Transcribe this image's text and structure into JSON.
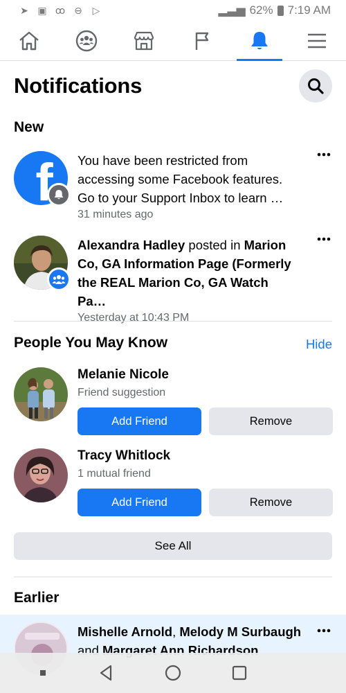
{
  "status": {
    "battery": "62%",
    "time": "7:19 AM"
  },
  "header": {
    "title": "Notifications"
  },
  "sections": {
    "new": "New",
    "people": "People You May Know",
    "hide": "Hide",
    "earlier": "Earlier"
  },
  "notifications": [
    {
      "text": "You have been restricted from accessing some Facebook features. Go to your Support Inbox to learn …",
      "time": "31 minutes ago"
    },
    {
      "name": "Alexandra Hadley",
      "action": " posted in ",
      "group": "Marion Co, GA Information Page (Formerly the REAL Marion Co, GA Watch Pa…",
      "time": "Yesterday at 10:43 PM"
    }
  ],
  "people": [
    {
      "name": "Melanie Nicole",
      "subtitle": "Friend suggestion",
      "add": "Add Friend",
      "remove": "Remove"
    },
    {
      "name": "Tracy Whitlock",
      "subtitle": "1 mutual friend",
      "add": "Add Friend",
      "remove": "Remove"
    }
  ],
  "see_all": "See All",
  "earlier_item": {
    "name1": "Mishelle Arnold",
    "sep": ", ",
    "name2": "Melody M Surbaugh",
    "and": " and ",
    "name3": "Margaret Ann Richardson"
  },
  "colors": {
    "accent": "#1877f2",
    "button_gray": "#e4e6eb",
    "secondary_text": "#65676b",
    "unread_bg": "#e7f3ff"
  }
}
